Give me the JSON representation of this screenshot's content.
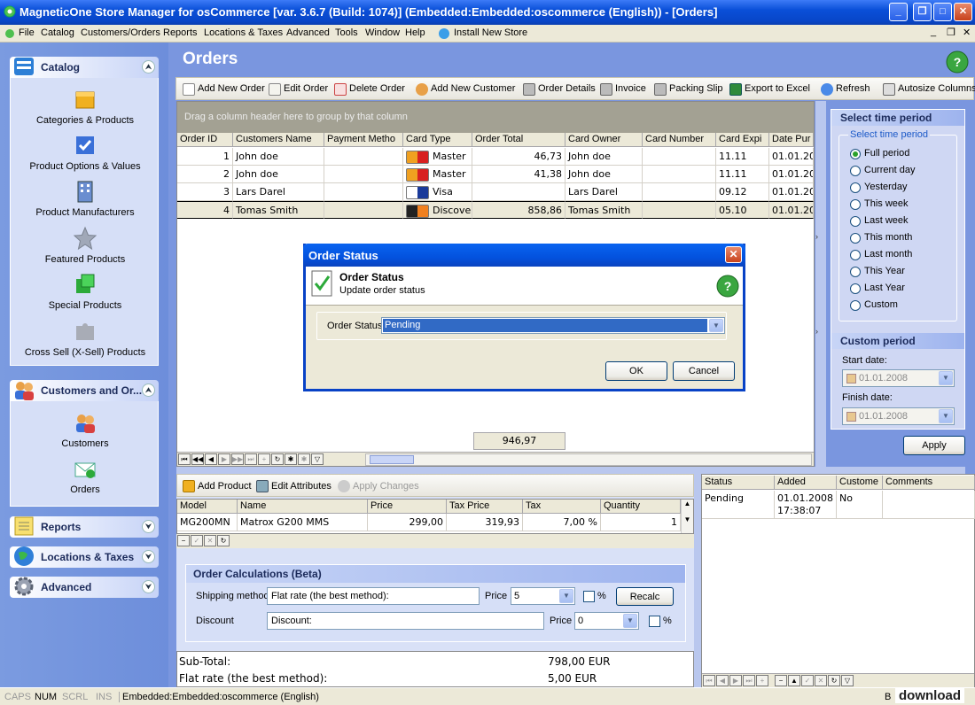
{
  "window": {
    "title": "MagneticOne Store Manager for osCommerce [var. 3.6.7 (Build: 1074)] (Embedded:Embedded:oscommerce (English))  - [Orders]"
  },
  "menu": [
    "File",
    "Catalog",
    "Customers/Orders",
    "Reports",
    "Locations & Taxes",
    "Advanced",
    "Tools",
    "Window",
    "Help",
    "Install New Store"
  ],
  "sidebar": {
    "catalog": {
      "title": "Catalog",
      "items": [
        "Categories & Products",
        "Product Options & Values",
        "Product Manufacturers",
        "Featured Products",
        "Special Products",
        "Cross Sell (X-Sell) Products"
      ]
    },
    "customers": {
      "title": "Customers and Or...",
      "items": [
        "Customers",
        "Orders"
      ]
    },
    "reports": {
      "title": "Reports"
    },
    "locations": {
      "title": "Locations & Taxes"
    },
    "advanced": {
      "title": "Advanced"
    }
  },
  "page": {
    "title": "Orders"
  },
  "toolbar": [
    "Add New Order",
    "Edit Order",
    "Delete Order",
    "Add New Customer",
    "Order Details",
    "Invoice",
    "Packing Slip",
    "Export to Excel",
    "Refresh",
    "Autosize Columns"
  ],
  "grid": {
    "group_hint": "Drag a column header here to group by that column",
    "columns": [
      "Order ID",
      "Customers Name",
      "Payment Metho",
      "Card Type",
      "Order Total",
      "Card Owner",
      "Card Number",
      "Card Expi",
      "Date Pur"
    ],
    "rows": [
      {
        "id": "1",
        "name": "John doe",
        "payment": "",
        "card_type": "Master",
        "total": "46,73",
        "owner": "John doe",
        "number": "",
        "expiry": "11.11",
        "date": "01.01.20"
      },
      {
        "id": "2",
        "name": "John doe",
        "payment": "",
        "card_type": "Master",
        "total": "41,38",
        "owner": "John doe",
        "number": "",
        "expiry": "11.11",
        "date": "01.01.20"
      },
      {
        "id": "3",
        "name": "Lars Darel",
        "payment": "",
        "card_type": "Visa",
        "total": "",
        "owner": "Lars Darel",
        "number": "",
        "expiry": "09.12",
        "date": "01.01.20"
      },
      {
        "id": "4",
        "name": "Tomas Smith",
        "payment": "",
        "card_type": "Discove",
        "total": "858,86",
        "owner": "Tomas Smith",
        "number": "",
        "expiry": "05.10",
        "date": "01.01.20"
      }
    ],
    "footer_total": "946,97"
  },
  "time_period": {
    "header": "Select time period",
    "group_label": "Select time period",
    "options": [
      "Full period",
      "Current day",
      "Yesterday",
      "This week",
      "Last week",
      "This month",
      "Last month",
      "This Year",
      "Last Year",
      "Custom"
    ],
    "selected": "Full period"
  },
  "custom_period": {
    "header": "Custom period",
    "start_label": "Start date:",
    "start_value": "01.01.2008",
    "finish_label": "Finish date:",
    "finish_value": "01.01.2008",
    "apply": "Apply"
  },
  "dialog": {
    "title": "Order Status",
    "heading": "Order Status",
    "subheading": "Update order status",
    "field_label": "Order Status",
    "field_value": "Pending",
    "ok": "OK",
    "cancel": "Cancel"
  },
  "products_toolbar": [
    "Add Product",
    "Edit Attributes",
    "Apply Changes"
  ],
  "products": {
    "columns": [
      "Model",
      "Name",
      "Price",
      "Tax Price",
      "Tax",
      "Quantity"
    ],
    "rows": [
      {
        "model": "MG200MN",
        "name": "Matrox G200 MMS",
        "price": "299,00",
        "tax_price": "319,93",
        "tax": "7,00 %",
        "qty": "1"
      }
    ]
  },
  "calc": {
    "header": "Order Calculations (Beta)",
    "shipping_label": "Shipping method",
    "shipping_value": "Flat rate (the best method):",
    "price_label": "Price",
    "shipping_price": "5",
    "percent": "%",
    "recalc": "Recalc",
    "discount_label": "Discount",
    "discount_value": "Discount:",
    "discount_price": "0"
  },
  "totals": [
    {
      "label": "Sub-Total:",
      "value": "798,00 EUR"
    },
    {
      "label": "Flat rate (the best method):",
      "value": "5,00 EUR"
    }
  ],
  "history": {
    "columns": [
      "Status",
      "Added",
      "Custome",
      "Comments"
    ],
    "rows": [
      {
        "status": "Pending",
        "added": "01.01.2008\n17:38:07",
        "customer": "No",
        "comments": ""
      }
    ]
  },
  "statusbar": {
    "caps": "CAPS",
    "num": "NUM",
    "scrl": "SCRL",
    "ins": "INS",
    "connection": "Embedded:Embedded:oscommerce (English)",
    "b": "B"
  },
  "watermark": "download",
  "colors": {
    "title_blue": "#0a4fd8",
    "sidebar": "#7a96df",
    "highlight": "#316ac5",
    "xp_beige": "#ece9d8"
  }
}
